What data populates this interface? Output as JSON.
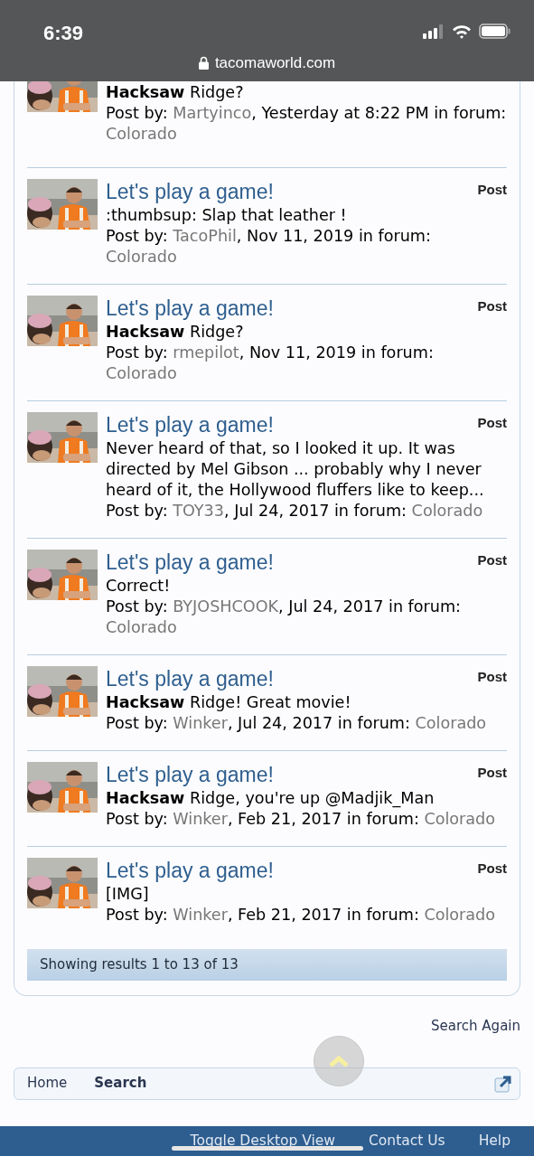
{
  "status_bar": {
    "time": "6:39",
    "url": "tacomaworld.com"
  },
  "results": [
    {
      "snippet": "**Hacksaw** Ridge?",
      "prefix": "Post by:",
      "author": "Martyinco",
      "middle": ", Yesterday at 8:22 PM in forum:",
      "forum": "Colorado",
      "cropped": true
    },
    {
      "title": "Let's play a game!",
      "type_label": "Post",
      "snippet": ":thumbsup: Slap that leather !",
      "prefix": "Post by:",
      "author": "TacoPhil",
      "middle": ", Nov 11, 2019 in forum:",
      "forum": "Colorado",
      "cropped": false
    },
    {
      "title": "Let's play a game!",
      "type_label": "Post",
      "snippet": "**Hacksaw** Ridge?",
      "prefix": "Post by:",
      "author": "rmepilot",
      "middle": ", Nov 11, 2019 in forum:",
      "forum": "Colorado",
      "cropped": false
    },
    {
      "title": "Let's play a game!",
      "type_label": "Post",
      "snippet": "Never heard of that, so I looked it up. It was directed by Mel Gibson ... probably why I never heard of it, the Hollywood fluffers like to keep...",
      "prefix": "Post by:",
      "author": "TOY33",
      "middle": ", Jul 24, 2017 in forum:",
      "forum": "Colorado",
      "cropped": false
    },
    {
      "title": "Let's play a game!",
      "type_label": "Post",
      "snippet": "Correct!",
      "prefix": "Post by:",
      "author": "BYJOSHCOOK",
      "middle": ", Jul 24, 2017 in forum:",
      "forum": "Colorado",
      "cropped": false
    },
    {
      "title": "Let's play a game!",
      "type_label": "Post",
      "snippet": "**Hacksaw** Ridge! Great movie!",
      "prefix": "Post by:",
      "author": "Winker",
      "middle": ", Jul 24, 2017 in forum:",
      "forum": "Colorado",
      "cropped": false
    },
    {
      "title": "Let's play a game!",
      "type_label": "Post",
      "snippet": "**Hacksaw** Ridge, you're up @Madjik_Man",
      "prefix": "Post by:",
      "author": "Winker",
      "middle": ", Feb 21, 2017 in forum:",
      "forum": "Colorado",
      "cropped": false
    },
    {
      "title": "Let's play a game!",
      "type_label": "Post",
      "snippet": "[IMG]",
      "prefix": "Post by:",
      "author": "Winker",
      "middle": ", Feb 21, 2017 in forum:",
      "forum": "Colorado",
      "cropped": false
    }
  ],
  "results_summary": "Showing results 1 to 13 of 13",
  "search_again": "Search Again",
  "breadcrumb": [
    {
      "label": "Home",
      "selected": false
    },
    {
      "label": "Search",
      "selected": true
    }
  ],
  "footer_links": [
    "Toggle Desktop View",
    "Contact Us",
    "Help"
  ]
}
